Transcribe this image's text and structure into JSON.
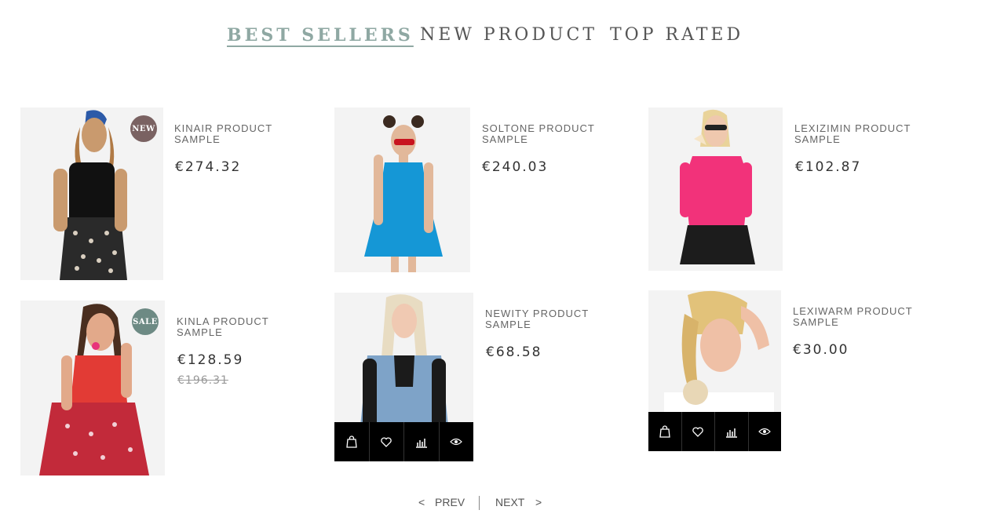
{
  "tabs": [
    {
      "label": "BEST SELLERS",
      "active": true
    },
    {
      "label": "NEW PRODUCT",
      "active": false
    },
    {
      "label": "TOP RATED",
      "active": false
    }
  ],
  "products": [
    {
      "name_line1": "KINAIR PRODUCT",
      "name_line2": "SAMPLE",
      "price": "€274.32",
      "badge": "NEW",
      "badge_color": "#7a6262"
    },
    {
      "name_line1": "SOLTONE PRODUCT",
      "name_line2": "SAMPLE",
      "price": "€240.03"
    },
    {
      "name_line1": "LEXIZIMIN PRODUCT",
      "name_line2": "SAMPLE",
      "price": "€102.87"
    },
    {
      "name_line1": "KINLA PRODUCT",
      "name_line2": "SAMPLE",
      "price": "€128.59",
      "old_price": "€196.31",
      "badge": "SALE",
      "badge_color": "#6d8a84"
    },
    {
      "name_line1": "NEWITY PRODUCT",
      "name_line2": "SAMPLE",
      "price": "€68.58"
    },
    {
      "name_line1": "LEXIWARM PRODUCT",
      "name_line2": "SAMPLE",
      "price": "€30.00"
    }
  ],
  "actions": [
    "shopping-bag-icon",
    "heart-icon",
    "compare-chart-icon",
    "eye-icon"
  ],
  "pager": {
    "prev_arrow": "<",
    "prev": "PREV",
    "next": "NEXT",
    "next_arrow": ">"
  },
  "colors": {
    "accent": "#8fa8a3",
    "action_bar": "#000000"
  }
}
